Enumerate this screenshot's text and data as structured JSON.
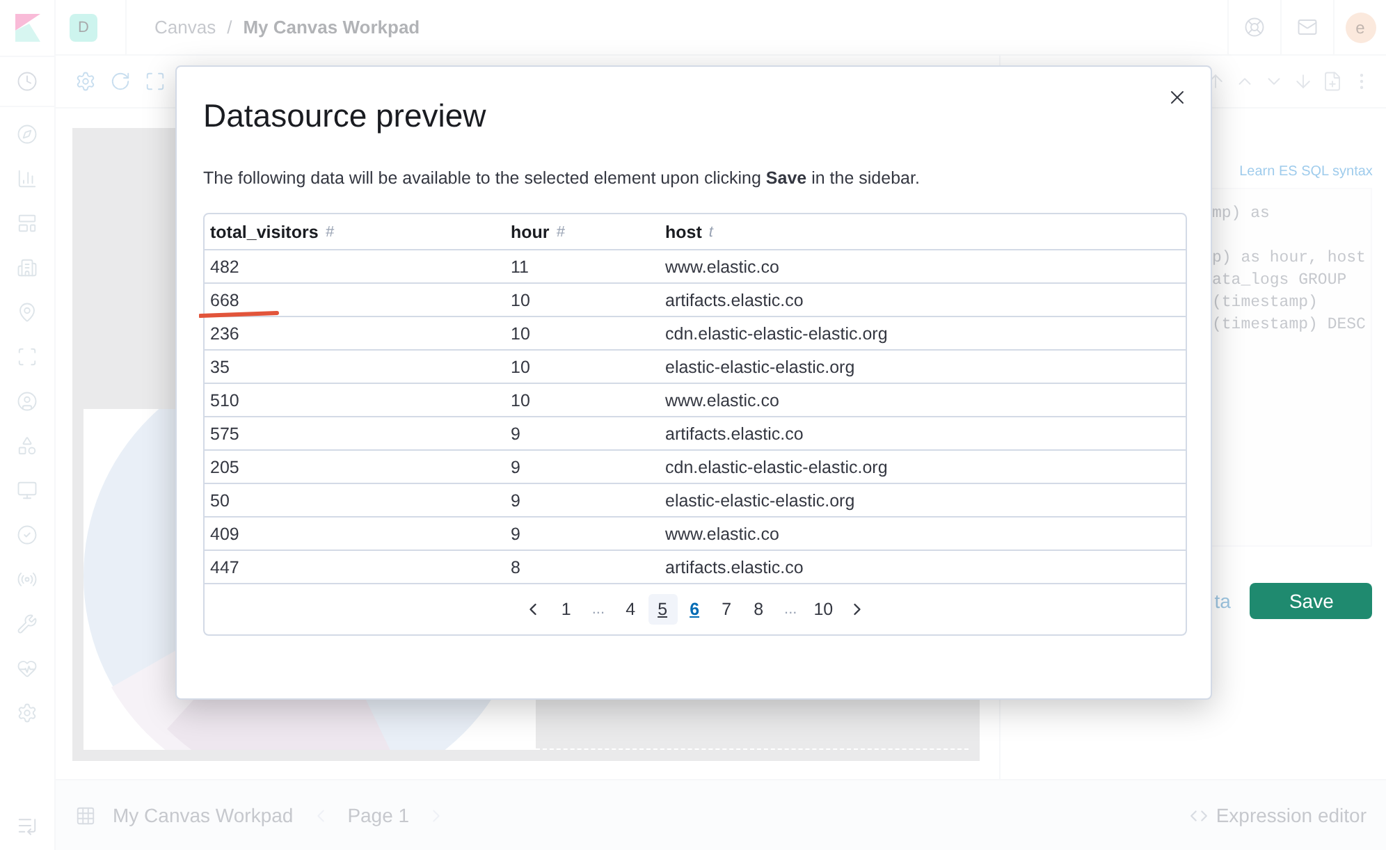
{
  "header": {
    "space_badge": "D",
    "separator": "/",
    "breadcrumbs": [
      {
        "label": "Canvas",
        "current": false
      },
      {
        "label": "My Canvas Workpad",
        "current": true
      }
    ],
    "avatar": "e"
  },
  "sidebar_panel": {
    "link": "Learn ES SQL syntax",
    "query_blocks": [
      [
        "mp) as"
      ],
      [
        "p) as hour, host",
        "ata_logs GROUP",
        "(timestamp)",
        "(timestamp) DESC"
      ]
    ],
    "secondary_button": "ta",
    "save_button": "Save"
  },
  "footer": {
    "workpad": "My Canvas Workpad",
    "page": "Page 1",
    "expression_editor": "Expression editor"
  },
  "modal": {
    "title": "Datasource preview",
    "description": "The following data will be available to the selected element upon clicking **Save** in the sidebar.",
    "columns": [
      {
        "label": "total_visitors",
        "type_glyph": "#"
      },
      {
        "label": "hour",
        "type_glyph": "#"
      },
      {
        "label": "host",
        "type_glyph": "t"
      }
    ],
    "rows": [
      {
        "cells": [
          "482",
          "11",
          "www.elastic.co"
        ],
        "underlined": false
      },
      {
        "cells": [
          "668",
          "10",
          "artifacts.elastic.co"
        ],
        "underlined": true
      },
      {
        "cells": [
          "236",
          "10",
          "cdn.elastic-elastic-elastic.org"
        ],
        "underlined": false
      },
      {
        "cells": [
          "35",
          "10",
          "elastic-elastic-elastic.org"
        ],
        "underlined": false
      },
      {
        "cells": [
          "510",
          "10",
          "www.elastic.co"
        ],
        "underlined": false
      },
      {
        "cells": [
          "575",
          "9",
          "artifacts.elastic.co"
        ],
        "underlined": false
      },
      {
        "cells": [
          "205",
          "9",
          "cdn.elastic-elastic-elastic.org"
        ],
        "underlined": false
      },
      {
        "cells": [
          "50",
          "9",
          "elastic-elastic-elastic.org"
        ],
        "underlined": false
      },
      {
        "cells": [
          "409",
          "9",
          "www.elastic.co"
        ],
        "underlined": false
      },
      {
        "cells": [
          "447",
          "8",
          "artifacts.elastic.co"
        ],
        "underlined": false
      }
    ],
    "pagination": [
      {
        "kind": "page",
        "label": "1",
        "selected": false,
        "hovered": false
      },
      {
        "kind": "ellipsis",
        "label": "..."
      },
      {
        "kind": "page",
        "label": "4",
        "selected": false,
        "hovered": false
      },
      {
        "kind": "page",
        "label": "5",
        "selected": false,
        "hovered": true
      },
      {
        "kind": "page",
        "label": "6",
        "selected": true,
        "hovered": false
      },
      {
        "kind": "page",
        "label": "7",
        "selected": false,
        "hovered": false
      },
      {
        "kind": "page",
        "label": "8",
        "selected": false,
        "hovered": false
      },
      {
        "kind": "ellipsis",
        "label": "..."
      },
      {
        "kind": "page",
        "label": "10",
        "selected": false,
        "hovered": false
      }
    ]
  }
}
